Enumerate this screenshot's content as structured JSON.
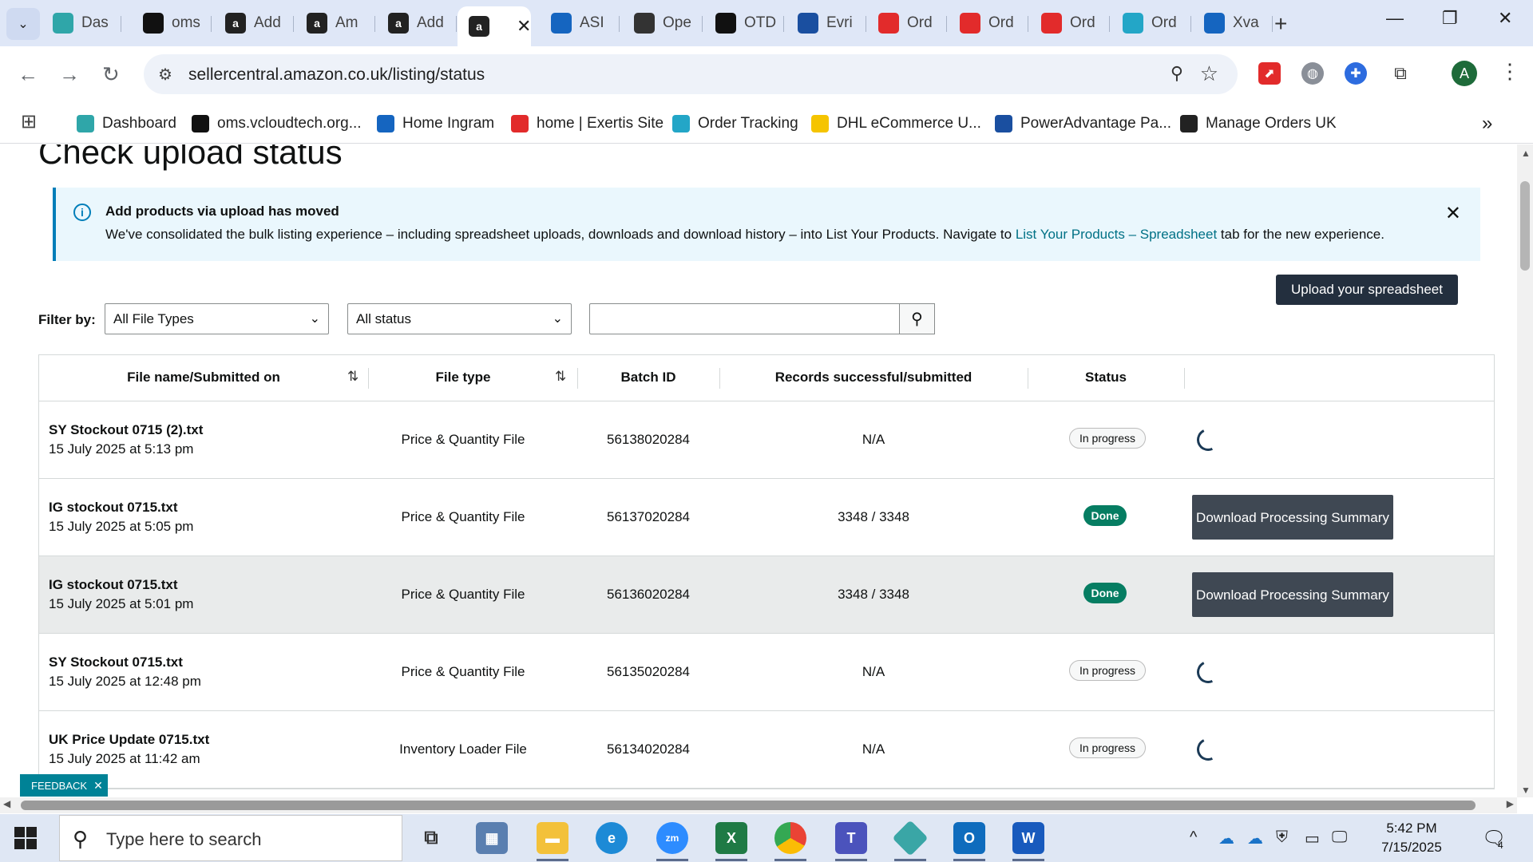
{
  "browser": {
    "tabs": [
      {
        "label": "Das",
        "icon": "dashboard-icon",
        "color": "#2fa6a9"
      },
      {
        "label": "oms",
        "icon": "oms-icon",
        "color": "#111111"
      },
      {
        "label": "Add",
        "icon": "amazon-icon",
        "color": "#222222"
      },
      {
        "label": "Am",
        "icon": "amazon-icon",
        "color": "#222222"
      },
      {
        "label": "Add",
        "icon": "amazon-icon",
        "color": "#222222"
      },
      {
        "label": "",
        "icon": "amazon-icon",
        "color": "#222222",
        "active": true
      },
      {
        "label": "ASI",
        "icon": "asi-icon",
        "color": "#1565c0"
      },
      {
        "label": "Ope",
        "icon": "openai-icon",
        "color": "#333333"
      },
      {
        "label": "OTD",
        "icon": "otd-icon",
        "color": "#111111"
      },
      {
        "label": "Evri",
        "icon": "evri-icon",
        "color": "#1a4fa0"
      },
      {
        "label": "Ord",
        "icon": "exertis-icon",
        "color": "#e22b2b"
      },
      {
        "label": "Ord",
        "icon": "exertis-icon",
        "color": "#e22b2b"
      },
      {
        "label": "Ord",
        "icon": "exertis-icon",
        "color": "#e22b2b"
      },
      {
        "label": "Ord",
        "icon": "c-icon",
        "color": "#23a6c7"
      },
      {
        "label": "Xva",
        "icon": "xvantage-icon",
        "color": "#1565c0"
      }
    ],
    "active_tab_close": "✕",
    "new_tab": "+",
    "url": "sellercentral.amazon.co.uk/listing/status",
    "avatar_letter": "A"
  },
  "bookmarks": [
    {
      "label": "Dashboard",
      "icon": "dashboard-icon",
      "color": "#2fa6a9"
    },
    {
      "label": "oms.vcloudtech.org...",
      "icon": "oms-icon",
      "color": "#111111"
    },
    {
      "label": "Home Ingram",
      "icon": "ingram-icon",
      "color": "#1565c0"
    },
    {
      "label": "home | Exertis Site",
      "icon": "exertis-icon",
      "color": "#e22b2b"
    },
    {
      "label": "Order Tracking",
      "icon": "c-icon",
      "color": "#23a6c7"
    },
    {
      "label": "DHL eCommerce U...",
      "icon": "dhl-icon",
      "color": "#f5c400"
    },
    {
      "label": "PowerAdvantage Pa...",
      "icon": "poweradvantage-icon",
      "color": "#1a4fa0"
    },
    {
      "label": "Manage Orders UK",
      "icon": "amazon-icon",
      "color": "#222222"
    }
  ],
  "page": {
    "title": "Check upload status",
    "banner": {
      "title": "Add products via upload has moved",
      "body_prefix": "We've consolidated the bulk listing experience – including spreadsheet uploads, downloads and download history – into List Your Products. Navigate to ",
      "link": "List Your Products – Spreadsheet",
      "body_suffix": " tab for the new experience."
    },
    "upload_button": "Upload your spreadsheet",
    "filter_label": "Filter by:",
    "file_type_select": "All File Types",
    "status_select": "All status",
    "search_value": "",
    "table": {
      "headers": {
        "file_name": "File name/Submitted on",
        "file_type": "File type",
        "batch_id": "Batch ID",
        "records": "Records successful/submitted",
        "status": "Status"
      },
      "rows": [
        {
          "name": "SY Stockout 0715 (2).txt",
          "date": "15 July 2025 at 5:13 pm",
          "type": "Price & Quantity File",
          "batch": "56138020284",
          "records": "N/A",
          "status": "In progress",
          "action": "spinner"
        },
        {
          "name": "IG stockout 0715.txt",
          "date": "15 July 2025 at 5:05 pm",
          "type": "Price & Quantity File",
          "batch": "56137020284",
          "records": "3348 / 3348",
          "status": "Done",
          "action": "Download Processing Summary"
        },
        {
          "name": "IG stockout 0715.txt",
          "date": "15 July 2025 at 5:01 pm",
          "type": "Price & Quantity File",
          "batch": "56136020284",
          "records": "3348 / 3348",
          "status": "Done",
          "action": "Download Processing Summary"
        },
        {
          "name": "SY Stockout 0715.txt",
          "date": "15 July 2025 at 12:48 pm",
          "type": "Price & Quantity File",
          "batch": "56135020284",
          "records": "N/A",
          "status": "In progress",
          "action": "spinner"
        },
        {
          "name": "UK Price Update 0715.txt",
          "date": "15 July 2025 at 11:42 am",
          "type": "Inventory Loader File",
          "batch": "56134020284",
          "records": "N/A",
          "status": "In progress",
          "action": "spinner"
        }
      ]
    },
    "feedback": "FEEDBACK"
  },
  "taskbar": {
    "search_placeholder": "Type here to search",
    "time": "5:42 PM",
    "date": "7/15/2025",
    "notification_count": "4"
  },
  "colors": {
    "banner_border": "#007eb9",
    "done_badge": "#067d62",
    "dark_button": "#232f3e",
    "link": "#007185"
  }
}
